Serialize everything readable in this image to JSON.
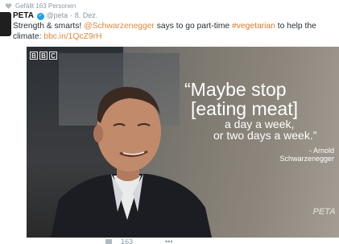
{
  "liked_by": {
    "text": "Gefällt 163 Personen"
  },
  "tweet": {
    "author": "PETA",
    "handle": "@peta",
    "separator": "·",
    "date": "8. Dez.",
    "text_part1": "Strength & smarts! ",
    "mention": "@Schwarzenegger",
    "text_part2": " says to go part-time ",
    "hashtag": "#vegetarian",
    "text_part3": " to help the climate: ",
    "link": "bbc.in/1QcZ9rH"
  },
  "media": {
    "logo_letters": [
      "B",
      "B",
      "C"
    ],
    "quote_line1": "“Maybe stop",
    "quote_line2": "[eating meat]",
    "quote_line3": "a day a week,",
    "quote_line4": "or two days a week.”",
    "attribution_line1": "- Arnold",
    "attribution_line2": "Schwarzenegger",
    "watermark": "PETA"
  },
  "actions": {
    "likes_count": "163",
    "more": "•••"
  },
  "colors": {
    "accent": "#e0883c",
    "verified": "#1da1f2",
    "muted": "#8899a6"
  }
}
